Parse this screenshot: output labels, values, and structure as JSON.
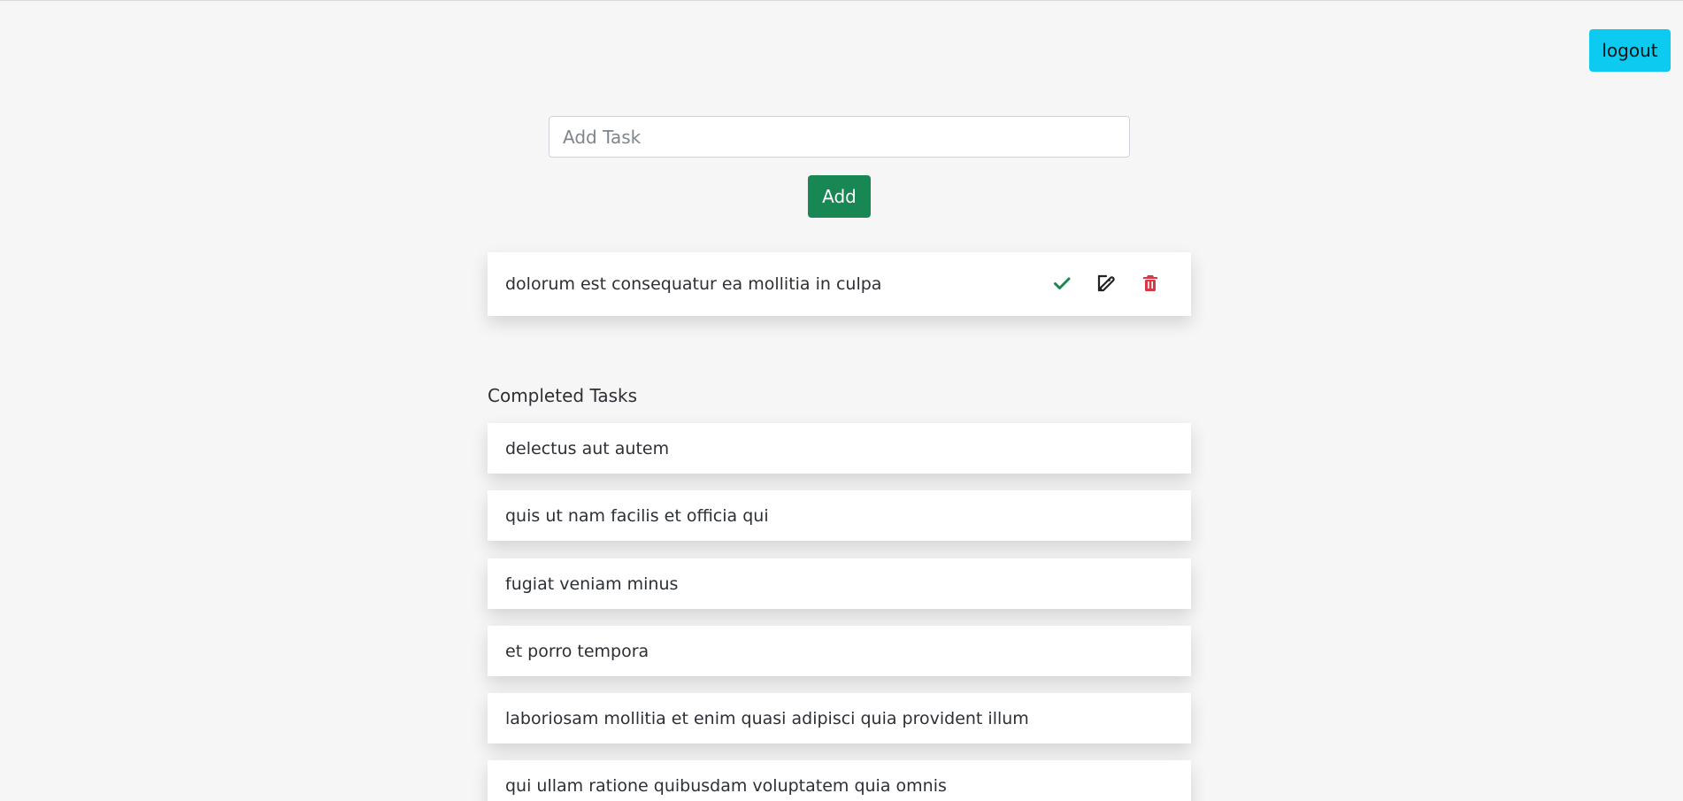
{
  "header": {
    "logout_label": "logout"
  },
  "add_task": {
    "placeholder": "Add Task",
    "value": "",
    "add_label": "Add"
  },
  "active_tasks": [
    {
      "text": "dolorum est consequatur ea mollitia in culpa",
      "actions": {
        "complete_icon": "check-icon",
        "edit_icon": "edit-icon",
        "delete_icon": "trash-icon"
      }
    }
  ],
  "completed_tasks": {
    "title": "Completed Tasks",
    "items": [
      {
        "text": "delectus aut autem"
      },
      {
        "text": "quis ut nam facilis et officia qui"
      },
      {
        "text": "fugiat veniam minus"
      },
      {
        "text": "et porro tempora"
      },
      {
        "text": "laboriosam mollitia et enim quasi adipisci quia provident illum"
      },
      {
        "text": "qui ullam ratione quibusdam voluptatem quia omnis"
      }
    ]
  },
  "colors": {
    "page_bg": "#f6f6f6",
    "logout_bg": "#0dcaf0",
    "add_bg": "#198754",
    "check_icon": "#198754",
    "delete_icon": "#dc3545"
  }
}
